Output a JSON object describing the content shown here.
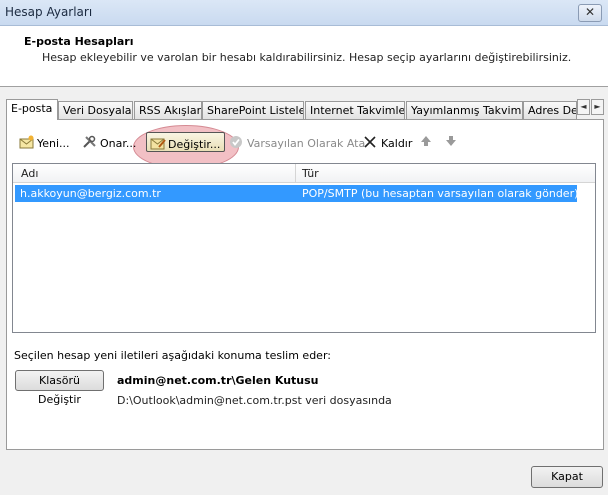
{
  "window": {
    "title": "Hesap Ayarları",
    "close_glyph": "✕"
  },
  "header": {
    "title": "E-posta Hesapları",
    "subtitle": "Hesap ekleyebilir ve varolan bir hesabı kaldırabilirsiniz. Hesap seçip ayarlarını değiştirebilirsiniz."
  },
  "tabs": [
    {
      "label": "E-posta",
      "active": true
    },
    {
      "label": "Veri Dosyaları"
    },
    {
      "label": "RSS Akışları"
    },
    {
      "label": "SharePoint Listeleri"
    },
    {
      "label": "Internet Takvimleri"
    },
    {
      "label": "Yayımlanmış Takvimler"
    },
    {
      "label": "Adres Def"
    }
  ],
  "tab_scroll": {
    "left": "◄",
    "right": "►"
  },
  "toolbar": {
    "new_label": "Yeni...",
    "repair_label": "Onar...",
    "change_label": "Değiştir...",
    "set_default_label": "Varsayılan Olarak Ata",
    "remove_label": "Kaldır",
    "icons": {
      "new": "new-mail-icon",
      "repair": "tools-icon",
      "change": "change-settings-icon",
      "set_default": "check-icon",
      "remove": "x-icon",
      "up": "arrow-up-icon",
      "down": "arrow-down-icon"
    }
  },
  "accounts_table": {
    "columns": [
      "Adı",
      "Tür"
    ],
    "rows": [
      {
        "name": "h.akkoyun@bergiz.com.tr",
        "type": "POP/SMTP (bu hesaptan varsayılan olarak gönder)",
        "selected": true
      }
    ]
  },
  "delivery": {
    "label": "Seçilen hesap yeni iletileri aşağıdaki konuma teslim eder:",
    "change_folder_label": "Klasörü Değiştir",
    "target": "admin@net.com.tr\\Gelen Kutusu",
    "path": "D:\\Outlook\\admin@net.com.tr.pst veri dosyasında"
  },
  "footer": {
    "close_label": "Kapat"
  },
  "colors": {
    "selection": "#3399ff",
    "highlight_ring": "#e88c96"
  }
}
